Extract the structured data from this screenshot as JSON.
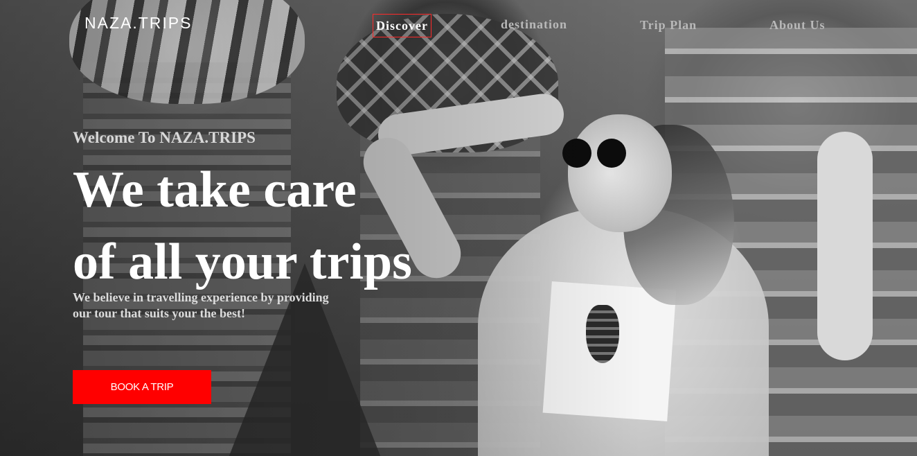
{
  "brand": {
    "logo": "NAZA.TRIPS"
  },
  "nav": {
    "items": [
      {
        "label": "Discover",
        "active": true
      },
      {
        "label": "destination",
        "active": false
      },
      {
        "label": "Trip Plan",
        "active": false
      },
      {
        "label": "About Us",
        "active": false
      }
    ]
  },
  "hero": {
    "welcome": "Welcome To NAZA.TRIPS",
    "headline_line1": "We take care",
    "headline_line2": "of all your trips",
    "tagline_line1": "We believe in travelling experience by providing",
    "tagline_line2": "our tour that suits your the best!",
    "cta_label": "BOOK A TRIP"
  },
  "colors": {
    "accent": "#ff0000",
    "nav_active_border": "#ff2a2a",
    "text_primary": "#ffffff",
    "nav_inactive": "#b9b9b9"
  },
  "background": {
    "type": "grayscale-photo",
    "subject": "woman-with-sunglasses",
    "backdrop": "onion-dome-cathedral"
  }
}
